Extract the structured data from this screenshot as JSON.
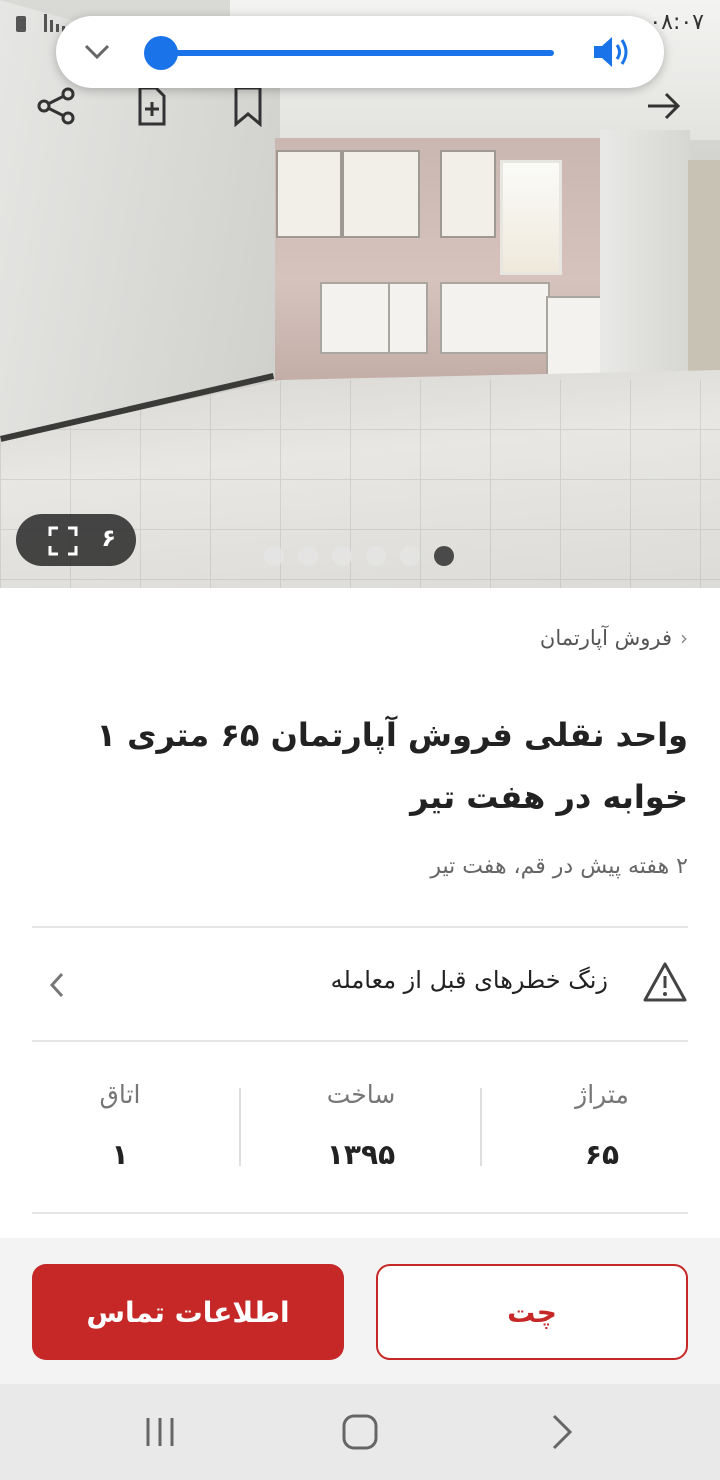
{
  "status_bar": {
    "time": "۰۸:۰۷"
  },
  "volume_popup": {
    "level_fraction": 0.0,
    "accent_color": "#1a73e8",
    "icons": [
      "chevron-down-icon",
      "speaker-icon"
    ]
  },
  "toolbar": {
    "icons": [
      "share-icon",
      "add-note-icon",
      "bookmark-icon",
      "back-arrow-icon"
    ]
  },
  "gallery": {
    "image_count": "۶",
    "dot_count": 6,
    "active_dot_index": 5
  },
  "breadcrumb": {
    "label": "فروش آپارتمان"
  },
  "listing": {
    "title": "واحد نقلی فروش آپارتمان ۶۵ متری ۱ خوابه در هفت تیر",
    "meta": "۲ هفته پیش در قم، هفت تیر"
  },
  "warning": {
    "text": "زنگ خطرهای قبل از معامله"
  },
  "stats": [
    {
      "label": "متراژ",
      "value": "۶۵"
    },
    {
      "label": "ساخت",
      "value": "۱۳۹۵"
    },
    {
      "label": "اتاق",
      "value": "۱"
    }
  ],
  "actions": {
    "contact_label": "اطلاعات تماس",
    "chat_label": "چت",
    "brand_color": "#c62828"
  },
  "system_nav": {
    "icons": [
      "recent-apps-icon",
      "home-icon",
      "back-icon"
    ]
  }
}
